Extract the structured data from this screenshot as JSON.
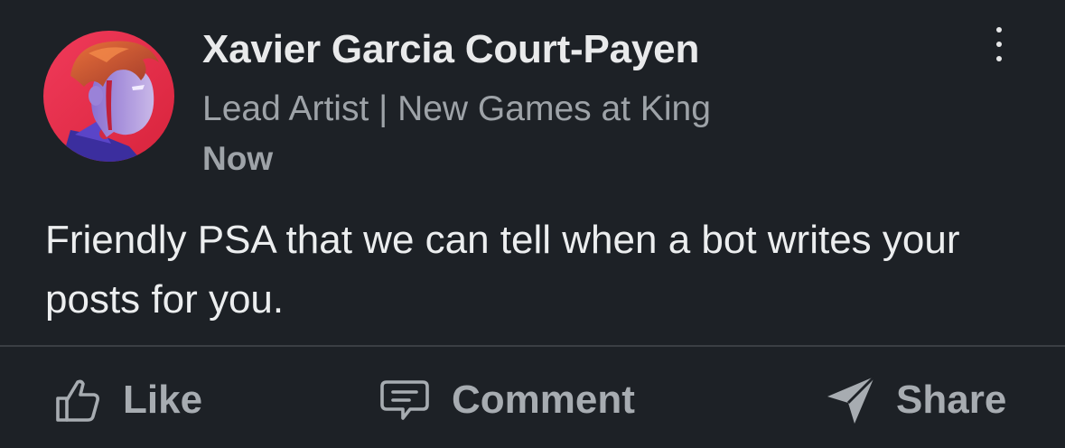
{
  "post": {
    "author": {
      "name": "Xavier Garcia Court-Payen",
      "headline": "Lead Artist | New Games at King",
      "time": "Now"
    },
    "body": "Friendly PSA that we can tell when a bot writes your posts for you.",
    "menu_icon": "more-vertical-icon"
  },
  "actions": {
    "like": {
      "label": "Like",
      "icon": "thumbs-up-icon"
    },
    "comment": {
      "label": "Comment",
      "icon": "comment-icon"
    },
    "share": {
      "label": "Share",
      "icon": "send-icon"
    }
  },
  "colors": {
    "background": "#1d2126",
    "name_text": "#e9eaeb",
    "secondary_text": "#9ea3a8",
    "body_text": "#eceeef",
    "action_text": "#a7acb1",
    "divider": "#3b3f44",
    "avatar_background": "#e8314a"
  }
}
